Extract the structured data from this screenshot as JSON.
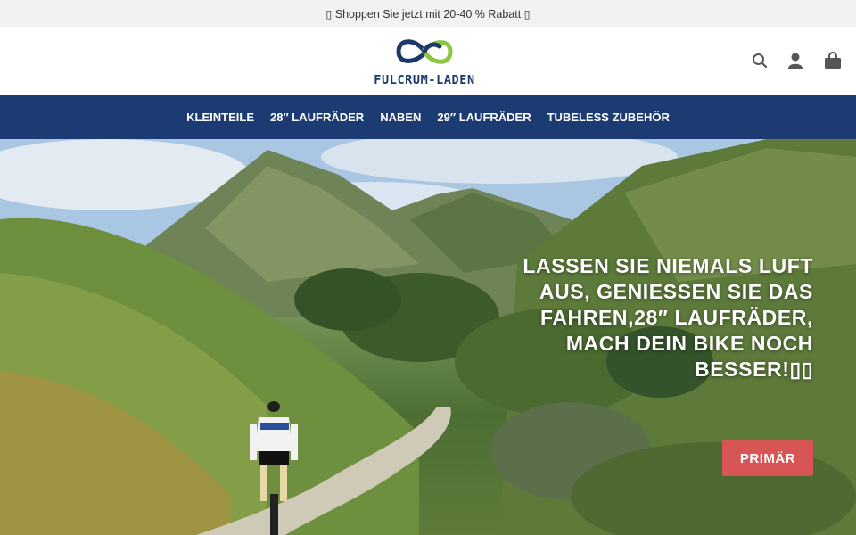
{
  "promo_bar": {
    "text": "▯ Shoppen Sie jetzt mit 20-40 % Rabatt ▯"
  },
  "header": {
    "logo_text": "FULCRUM-LADEN",
    "icons": [
      "search-icon",
      "account-icon",
      "cart-icon"
    ]
  },
  "nav": {
    "items": [
      {
        "label": "KLEINTEILE"
      },
      {
        "label": "28″ LAUFRÄDER"
      },
      {
        "label": "NABEN"
      },
      {
        "label": "29″ LAUFRÄDER"
      },
      {
        "label": "TUBELESS ZUBEHÖR"
      }
    ]
  },
  "hero": {
    "headline": "LASSEN SIE NIEMALS LUFT AUS, GENIESSEN SIE DAS FAHREN,28″ LAUFRÄDER, MACH DEIN BIKE NOCH BESSER!▯▯",
    "cta_label": "PRIMÄR"
  },
  "colors": {
    "nav_bg": "#1d3b73",
    "cta_bg": "#d85555",
    "logo_blue": "#1b3a6b",
    "logo_green": "#8cc63f",
    "promo_bg": "#f2f2f2"
  }
}
